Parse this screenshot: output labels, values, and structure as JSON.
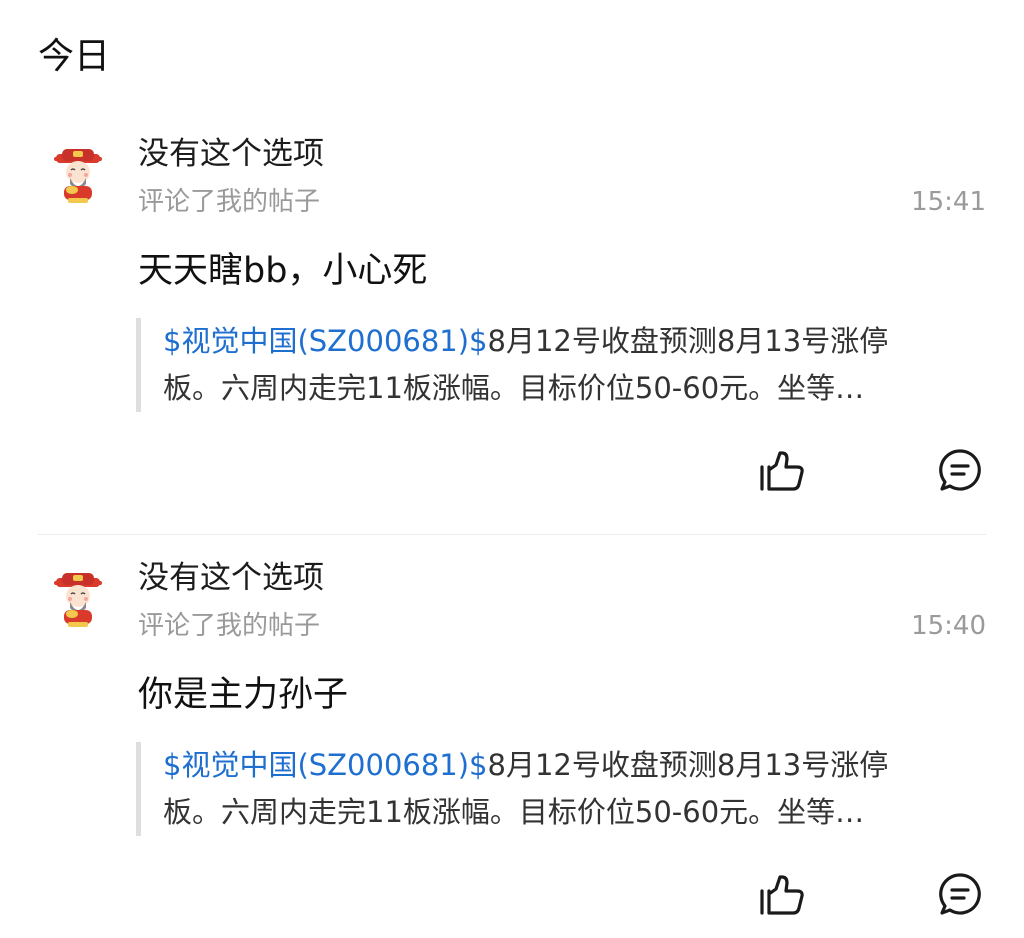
{
  "section": {
    "title": "今日"
  },
  "notifications": [
    {
      "username": "没有这个选项",
      "action": "评论了我的帖子",
      "time": "15:41",
      "comment": "天天瞎bb，小心死",
      "quote": {
        "stock": "$视觉中国(SZ000681)$",
        "line1_rest": "8月12号收盘预测8月13号涨停",
        "line2": "板。六周内走完11板涨幅。目标价位50-60元。坐等…"
      },
      "icons": {
        "like": "thumbs-up-icon",
        "reply": "comment-bubble-icon"
      }
    },
    {
      "username": "没有这个选项",
      "action": "评论了我的帖子",
      "time": "15:40",
      "comment": "你是主力孙子",
      "quote": {
        "stock": "$视觉中国(SZ000681)$",
        "line1_rest": "8月12号收盘预测8月13号涨停",
        "line2": "板。六周内走完11板涨幅。目标价位50-60元。坐等…"
      },
      "icons": {
        "like": "thumbs-up-icon",
        "reply": "comment-bubble-icon"
      }
    }
  ],
  "colors": {
    "link": "#1f6fd1",
    "muted_text": "#9a9a9a",
    "quote_bar": "#dedede"
  }
}
